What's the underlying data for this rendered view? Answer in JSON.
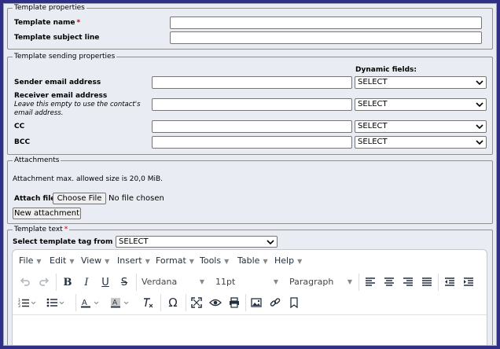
{
  "template_properties": {
    "legend": "Template properties",
    "name_label": "Template name",
    "required_mark": "*",
    "subject_label": "Template subject line",
    "name_value": "",
    "subject_value": ""
  },
  "sending_properties": {
    "legend": "Template sending properties",
    "dynamic_fields_label": "Dynamic fields:",
    "sender_label": "Sender email address",
    "receiver_label": "Receiver email address",
    "receiver_hint": "Leave this empty to use the contact's email address.",
    "cc_label": "CC",
    "bcc_label": "BCC",
    "select_value": "SELECT"
  },
  "attachments": {
    "legend": "Attachments",
    "max_size_text": "Attachment max. allowed size is 20,0 MiB.",
    "attach_file_label": "Attach file",
    "choose_file_button": "Choose File",
    "no_file_text": "No file chosen",
    "new_attachment_button": "New attachment"
  },
  "template_text": {
    "legend": "Template text",
    "required_mark": "*",
    "tag_select_label": "Select template tag from list:",
    "tag_select_value": "SELECT",
    "menu": [
      "File",
      "Edit",
      "View",
      "Insert",
      "Format",
      "Tools",
      "Table",
      "Help"
    ],
    "font_family": "Verdana",
    "font_size": "11pt",
    "block_format": "Paragraph"
  },
  "icons": [
    "undo-icon",
    "redo-icon",
    "bold-icon",
    "italic-icon",
    "underline-icon",
    "strikethrough-icon",
    "align-left-icon",
    "align-center-icon",
    "align-right-icon",
    "align-justify-icon",
    "outdent-icon",
    "indent-icon",
    "numbered-list-icon",
    "bullet-list-icon",
    "text-color-icon",
    "background-color-icon",
    "clear-formatting-icon",
    "special-character-icon",
    "fullscreen-icon",
    "preview-icon",
    "print-icon",
    "image-icon",
    "link-icon",
    "bookmark-icon",
    "chevron-down-icon"
  ],
  "colors": {
    "page_bg": "#e9ecf3",
    "outer_frame": "#2f2f86",
    "required": "#c00000"
  }
}
